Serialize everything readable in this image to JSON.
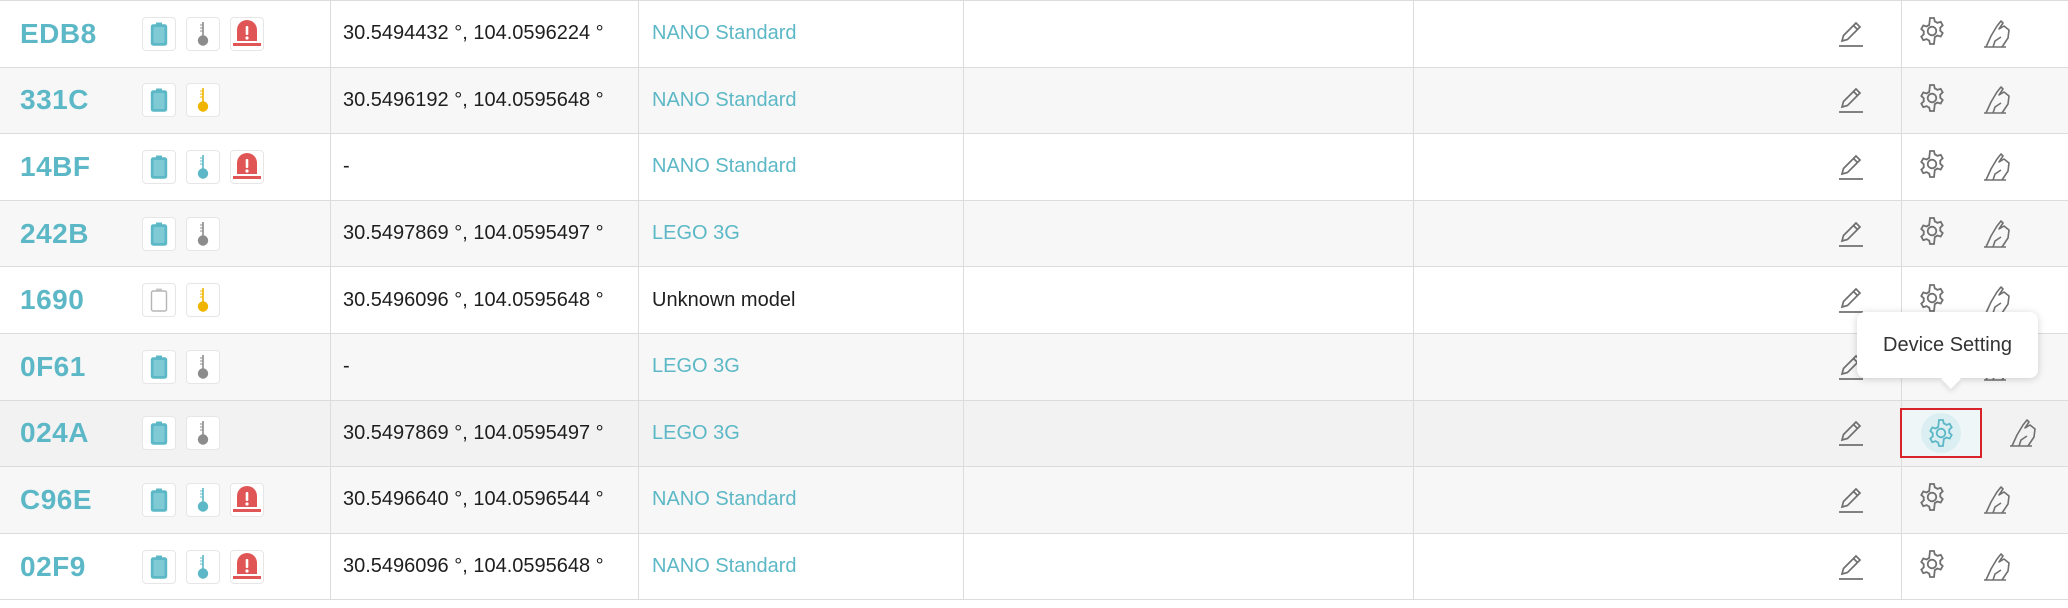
{
  "colors": {
    "accent": "#5cb8c6",
    "alert": "#e05656",
    "temp_warn": "#f0b400",
    "temp_gray": "#8c8c8c",
    "highlight_border": "#d8232a"
  },
  "rows": [
    {
      "id": "EDB8",
      "battery": "full",
      "temp": "gray",
      "alert": true,
      "coords": "30.5494432 °, 104.0596224 °",
      "model": "NANO Standard",
      "model_link": true
    },
    {
      "id": "331C",
      "battery": "full",
      "temp": "yellow",
      "alert": false,
      "coords": "30.5496192 °, 104.0595648 °",
      "model": "NANO Standard",
      "model_link": true
    },
    {
      "id": "14BF",
      "battery": "full",
      "temp": "blue",
      "alert": true,
      "coords": "-",
      "model": "NANO Standard",
      "model_link": true
    },
    {
      "id": "242B",
      "battery": "full",
      "temp": "gray",
      "alert": false,
      "coords": "30.5497869 °, 104.0595497 °",
      "model": "LEGO 3G",
      "model_link": true
    },
    {
      "id": "1690",
      "battery": "empty",
      "temp": "yellow",
      "alert": false,
      "coords": "30.5496096 °, 104.0595648 °",
      "model": "Unknown model",
      "model_link": false
    },
    {
      "id": "0F61",
      "battery": "full",
      "temp": "gray",
      "alert": false,
      "coords": "-",
      "model": "LEGO 3G",
      "model_link": true
    },
    {
      "id": "024A",
      "battery": "full",
      "temp": "gray",
      "alert": false,
      "coords": "30.5497869 °, 104.0595497 °",
      "model": "LEGO 3G",
      "model_link": true,
      "active_setting": true
    },
    {
      "id": "C96E",
      "battery": "full",
      "temp": "blue",
      "alert": true,
      "coords": "30.5496640 °, 104.0596544 °",
      "model": "NANO Standard",
      "model_link": true
    },
    {
      "id": "02F9",
      "battery": "full",
      "temp": "blue",
      "alert": true,
      "coords": "30.5496096 °, 104.0595648 °",
      "model": "NANO Standard",
      "model_link": true
    }
  ],
  "icons": {
    "edit": "pencil-icon",
    "setting": "gear-icon",
    "sign": "hand-pen-icon",
    "battery": "battery-icon",
    "temp": "thermometer-icon",
    "alert": "siren-alert-icon"
  },
  "tooltip": {
    "text": "Device Setting"
  }
}
